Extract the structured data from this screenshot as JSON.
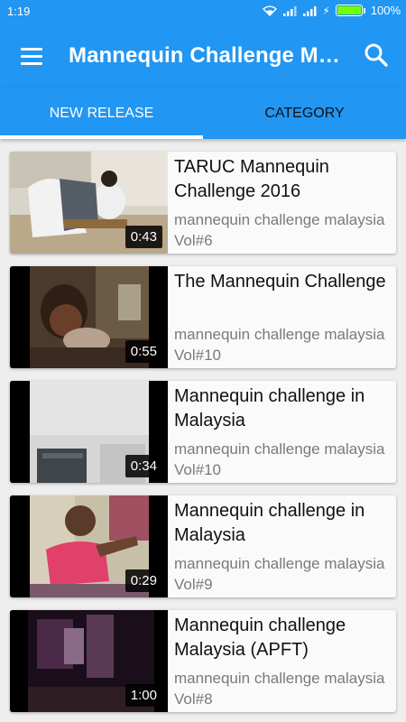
{
  "status": {
    "time": "1:19",
    "battery": "100%",
    "icons": [
      "wifi-icon",
      "signal-icon",
      "signal-icon",
      "charging-icon",
      "battery-icon"
    ]
  },
  "appbar": {
    "title": "Mannequin Challenge Malaysia",
    "menu_icon": "menu-icon",
    "search_icon": "search-icon"
  },
  "tabs": [
    {
      "label": "NEW RELEASE",
      "active": true
    },
    {
      "label": "CATEGORY",
      "active": false
    }
  ],
  "videos": [
    {
      "title": "TARUC Mannequin Challenge 2016",
      "subtitle": "mannequin challenge malaysia Vol#6",
      "duration": "0:43"
    },
    {
      "title": "The Mannequin Challenge",
      "subtitle": "mannequin challenge malaysia Vol#10",
      "duration": "0:55"
    },
    {
      "title": "Mannequin challenge in Malaysia",
      "subtitle": "mannequin challenge malaysia Vol#10",
      "duration": "0:34"
    },
    {
      "title": "Mannequin challenge in Malaysia",
      "subtitle": "mannequin challenge malaysia Vol#9",
      "duration": "0:29"
    },
    {
      "title": "Mannequin challenge Malaysia (APFT)",
      "subtitle": "mannequin challenge malaysia Vol#8",
      "duration": "1:00"
    }
  ],
  "colors": {
    "primary": "#2196F3",
    "background": "#eeeeee",
    "subtitle": "#7a7a7a"
  }
}
